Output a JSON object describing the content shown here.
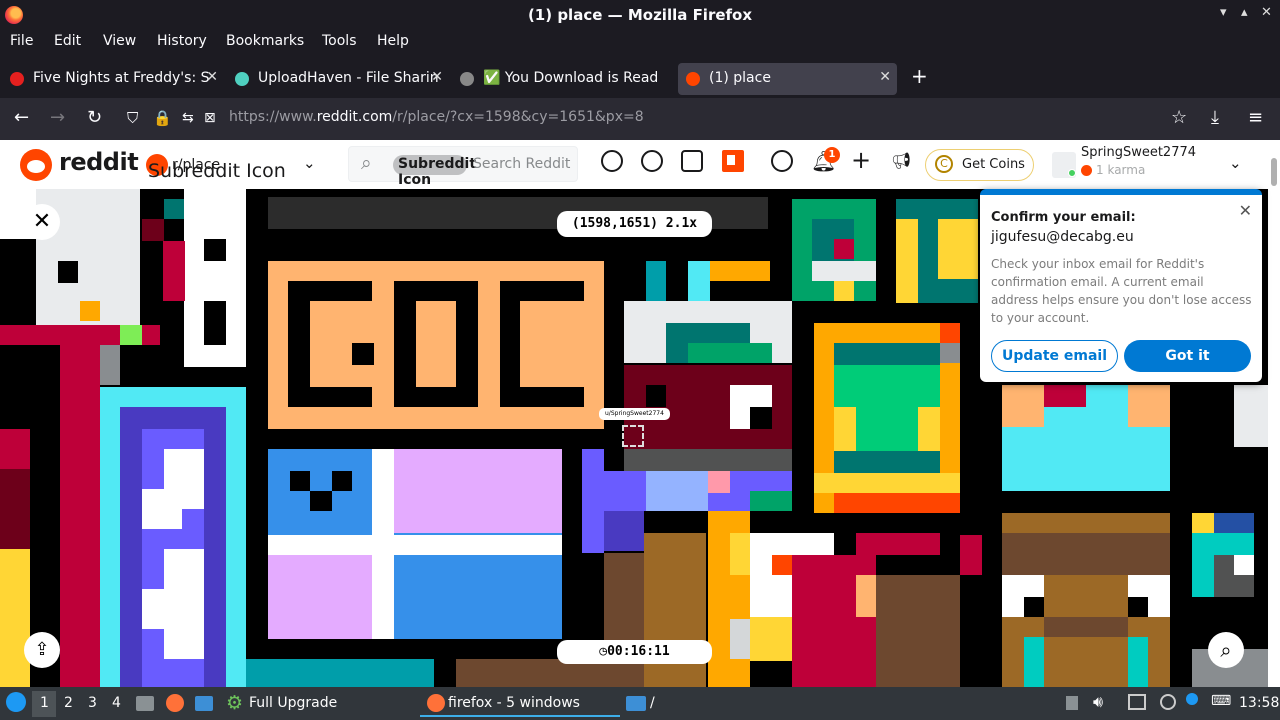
{
  "window": {
    "title": "(1) place — Mozilla Firefox"
  },
  "menu": [
    "File",
    "Edit",
    "View",
    "History",
    "Bookmarks",
    "Tools",
    "Help"
  ],
  "tabs": [
    {
      "label": "Five Nights at Freddy's: S",
      "fav": "#e5201f"
    },
    {
      "label": "UploadHaven - File Sharin",
      "fav": "#4fd0c0"
    },
    {
      "label": "✅ You Download is Read",
      "fav": "#888888"
    },
    {
      "label": "(1) place",
      "fav": "#ff4500"
    }
  ],
  "nav": {
    "url_prefix": "https://www.",
    "url_domain": "reddit.com",
    "url_rest": "/r/place/?cx=1598&cy=1651&px=8"
  },
  "reddit": {
    "logo_text": "reddit",
    "community": "r/place",
    "community_icon_alt": "Subreddit Icon",
    "search_icon_alt": "Subreddit Icon",
    "search_placeholder": "Search Reddit",
    "notification_count": "1",
    "get_coins": "Get Coins",
    "username": "SpringSweet2774",
    "karma": "1 karma"
  },
  "place": {
    "coords": "(1598,1651) 2.1x",
    "timer": "00:16:11",
    "cursor_user": "u/SpringSweet2774"
  },
  "popup": {
    "heading": "Confirm your email:",
    "email": "jigufesu@decabg.eu",
    "body": "Check your inbox email for Reddit's confirmation email. A current email address helps ensure you don't lose access to your account.",
    "update_label": "Update email",
    "gotit_label": "Got it"
  },
  "taskbar": {
    "desktops": [
      "1",
      "2",
      "3",
      "4"
    ],
    "app1": "Full Upgrade",
    "app2": "firefox - 5 windows",
    "app3": "/",
    "clock": "13:58"
  },
  "colors": {
    "reddit_orange": "#ff4500",
    "reddit_blue": "#0079d3",
    "firefox_chrome": "#1c1b22"
  }
}
